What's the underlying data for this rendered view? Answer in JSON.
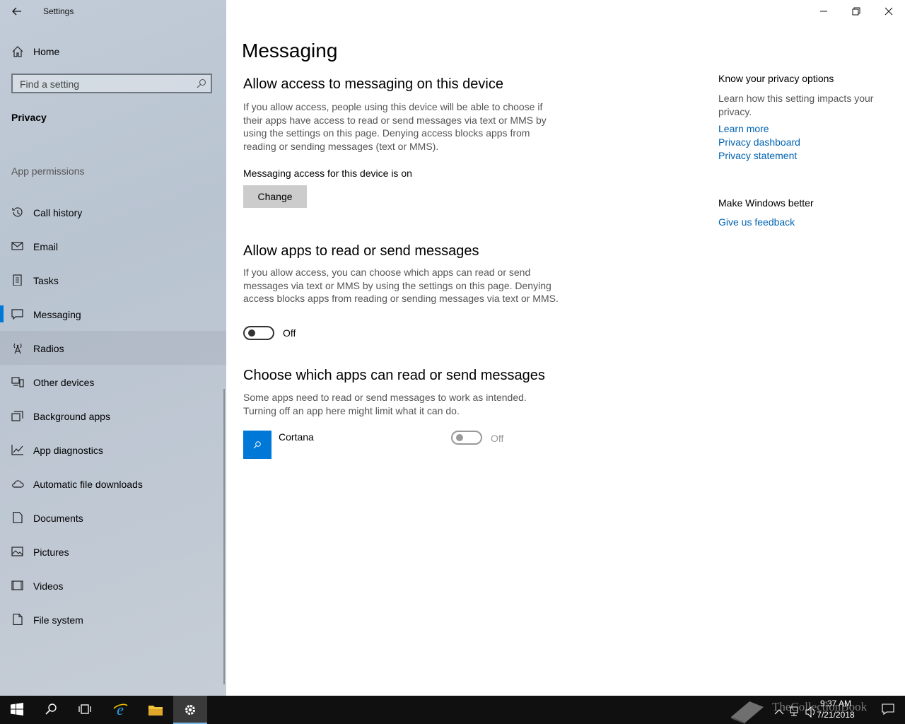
{
  "app": {
    "title": "Settings"
  },
  "sidebar": {
    "home_label": "Home",
    "search_placeholder": "Find a setting",
    "section_title": "Privacy",
    "group_title": "App permissions",
    "items": [
      {
        "label": "Call history",
        "icon": "history-icon"
      },
      {
        "label": "Email",
        "icon": "mail-icon"
      },
      {
        "label": "Tasks",
        "icon": "clipboard-icon"
      },
      {
        "label": "Messaging",
        "icon": "message-icon",
        "selected": true
      },
      {
        "label": "Radios",
        "icon": "radio-tower-icon"
      },
      {
        "label": "Other devices",
        "icon": "devices-icon"
      },
      {
        "label": "Background apps",
        "icon": "background-apps-icon"
      },
      {
        "label": "App diagnostics",
        "icon": "diagnostics-icon"
      },
      {
        "label": "Automatic file downloads",
        "icon": "cloud-icon"
      },
      {
        "label": "Documents",
        "icon": "document-icon"
      },
      {
        "label": "Pictures",
        "icon": "picture-icon"
      },
      {
        "label": "Videos",
        "icon": "video-icon"
      },
      {
        "label": "File system",
        "icon": "file-icon"
      }
    ]
  },
  "main": {
    "page_title": "Messaging",
    "section1": {
      "heading": "Allow access to messaging on this device",
      "description": "If you allow access, people using this device will be able to choose if their apps have access to read or send messages via text or MMS by using the settings on this page. Denying access blocks apps from reading or sending messages (text or MMS).",
      "status": "Messaging access for this device is on",
      "button_label": "Change"
    },
    "section2": {
      "heading": "Allow apps to read or send messages",
      "description": "If you allow access, you can choose which apps can read or send messages via text or MMS by using the settings on this page. Denying access blocks apps from reading or sending messages via text or MMS.",
      "toggle_label": "Off",
      "toggle_on": false
    },
    "section3": {
      "heading": "Choose which apps can read or send messages",
      "description": "Some apps need to read or send messages to work as intended. Turning off an app here might limit what it can do.",
      "apps": [
        {
          "name": "Cortana",
          "toggle_label": "Off",
          "enabled": false
        }
      ]
    }
  },
  "right_panel": {
    "privacy_heading": "Know your privacy options",
    "privacy_desc": "Learn how this setting impacts your privacy.",
    "links": [
      "Learn more",
      "Privacy dashboard",
      "Privacy statement"
    ],
    "feedback_heading": "Make Windows better",
    "feedback_link": "Give us feedback"
  },
  "taskbar": {
    "time": "9:37 AM",
    "date": "7/21/2018",
    "watermark": "TheCollectionBook",
    "accent": "#0078d7"
  }
}
